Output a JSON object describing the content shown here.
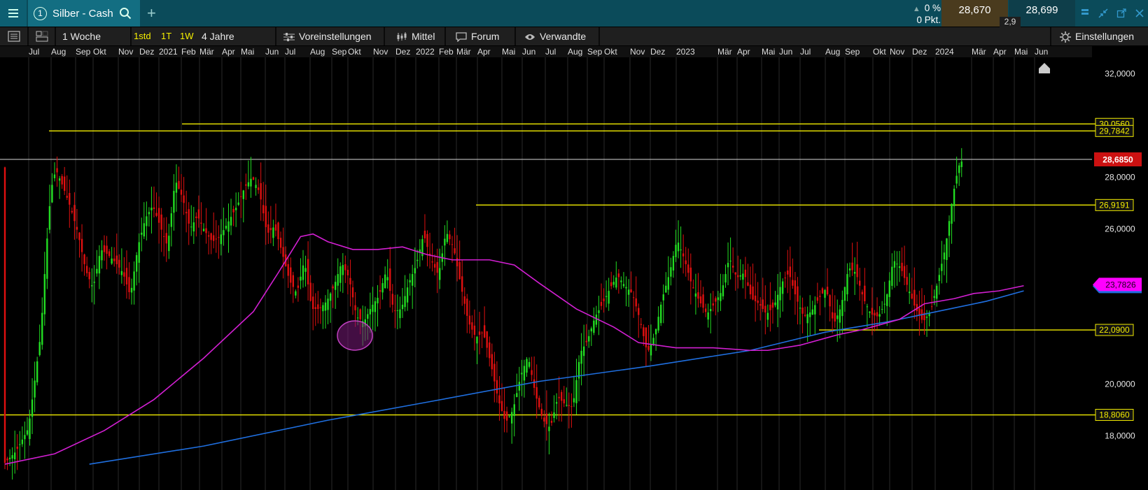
{
  "titlebar": {
    "menu_icon": "hamburger-icon",
    "instrument_number": "1",
    "instrument_name": "Silber - Cash",
    "search_icon": "search-icon",
    "add_tab": "+",
    "change_percent": "0 %",
    "change_points": "0 Pkt.",
    "bid": "28,670",
    "ask": "28,699",
    "spread": "2,9",
    "window_controls": [
      "pin-icon",
      "collapse-icon",
      "popout-icon",
      "close-icon"
    ]
  },
  "toolbar": {
    "list_icon": "list-icon",
    "layout_icon": "layout-icon",
    "period": "1 Woche",
    "intervals": [
      "1std",
      "1T",
      "1W"
    ],
    "range": "4 Jahre",
    "presets": "Voreinstellungen",
    "indicators": "Mittel",
    "forum": "Forum",
    "related": "Verwandte",
    "settings": "Einstellungen"
  },
  "time_axis": {
    "labels": [
      "Jul",
      "Aug",
      "Sep",
      "Okt",
      "Nov",
      "Dez",
      "2021",
      "Feb",
      "Mär",
      "Apr",
      "Mai",
      "Jun",
      "Jul",
      "Aug",
      "Sep",
      "Okt",
      "Nov",
      "Dez",
      "2022",
      "Feb",
      "Mär",
      "Apr",
      "Mai",
      "Jun",
      "Jul",
      "Aug",
      "Sep",
      "Okt",
      "Nov",
      "Dez",
      "2023",
      "Mär",
      "Apr",
      "Mai",
      "Jun",
      "Jul",
      "Aug",
      "Sep",
      "Okt",
      "Nov",
      "Dez",
      "2024",
      "Mär",
      "Apr",
      "Mai",
      "Jun"
    ]
  },
  "price_axis": {
    "ticks": [
      "32,0000",
      "28,0000",
      "26,0000",
      "20,0000",
      "18,0000"
    ]
  },
  "levels": [
    {
      "value": 30.056,
      "label": "30,0560",
      "color": "#f2ec00"
    },
    {
      "value": 29.7842,
      "label": "29,7842",
      "color": "#f2ec00"
    },
    {
      "value": 26.9191,
      "label": "26,9191",
      "color": "#f2ec00"
    },
    {
      "value": 22.09,
      "label": "22,0900",
      "color": "#f2ec00"
    },
    {
      "value": 18.806,
      "label": "18,8060",
      "color": "#f2ec00"
    }
  ],
  "current_price": {
    "value": 28.685,
    "label": "28,6850",
    "color": "#cc1111"
  },
  "ma_label": {
    "value": 23.7826,
    "label": "23,7826",
    "color": "#ff00ff"
  },
  "colors": {
    "up": "#22dd22",
    "down": "#e01010",
    "ma_fast": "#d21fd2",
    "ma_slow": "#1f6fe0",
    "level": "#f2ec00"
  },
  "chart_data": {
    "type": "candlestick",
    "title": "",
    "xlabel": "",
    "ylabel": "",
    "ylim": [
      17.0,
      33.0
    ],
    "moving_average_fast": [
      [
        0,
        16.9
      ],
      [
        20,
        17.3
      ],
      [
        40,
        18.2
      ],
      [
        60,
        19.4
      ],
      [
        80,
        21.0
      ],
      [
        100,
        22.8
      ],
      [
        110,
        24.3
      ],
      [
        119,
        25.7
      ],
      [
        124,
        25.8
      ],
      [
        130,
        25.5
      ],
      [
        140,
        25.2
      ],
      [
        150,
        25.2
      ],
      [
        160,
        25.3
      ],
      [
        170,
        25.0
      ],
      [
        180,
        24.8
      ],
      [
        195,
        24.8
      ],
      [
        205,
        24.6
      ],
      [
        215,
        23.9
      ],
      [
        230,
        22.9
      ],
      [
        245,
        22.2
      ],
      [
        255,
        21.6
      ],
      [
        270,
        21.4
      ],
      [
        285,
        21.4
      ],
      [
        300,
        21.3
      ],
      [
        307,
        21.3
      ],
      [
        320,
        21.5
      ],
      [
        335,
        21.9
      ],
      [
        345,
        22.1
      ],
      [
        360,
        22.5
      ],
      [
        370,
        23.1
      ],
      [
        382,
        23.3
      ],
      [
        390,
        23.5
      ],
      [
        400,
        23.6
      ],
      [
        410,
        23.8
      ]
    ],
    "moving_average_slow": [
      [
        34,
        16.9
      ],
      [
        80,
        17.6
      ],
      [
        130,
        18.6
      ],
      [
        170,
        19.3
      ],
      [
        215,
        20.1
      ],
      [
        260,
        20.7
      ],
      [
        300,
        21.3
      ],
      [
        330,
        22.0
      ],
      [
        355,
        22.4
      ],
      [
        380,
        22.9
      ],
      [
        395,
        23.2
      ],
      [
        410,
        23.6
      ]
    ],
    "highlight_ellipse": {
      "x": 126,
      "y": 22.5
    },
    "x_unit": "week"
  }
}
